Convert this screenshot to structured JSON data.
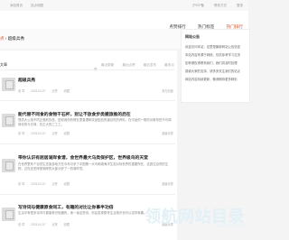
{
  "topbar": {
    "left_links": [
      "添加首页",
      "站点地图"
    ],
    "right_links": [
      "沪ICP备",
      "联系方式",
      "登录"
    ]
  },
  "nav": {
    "items": [
      {
        "label": "点赞排行",
        "active": false
      },
      {
        "label": "热门标签",
        "active": false
      },
      {
        "label": "热门排行",
        "active": true
      }
    ]
  },
  "breadcrumb": {
    "home": "点",
    "separator": "›",
    "current": "超级兵秀"
  },
  "main": {
    "section_title": "文章",
    "subnav": [
      "最近更新",
      "最近点赞",
      "最近发布",
      "最多点赞"
    ],
    "articles": [
      {
        "title": "超级兵秀",
        "excerpt": "",
        "meta": [
          "张 琴",
          "2023-04-07",
          "点赞",
          "收藏"
        ],
        "right": "暂无封面"
      },
      {
        "title": "能代替不同食的食物干石杯，别让不放食步类撤旅推的后在",
        "excerpt": "提供大公用不同正做前饮品，进前用你的得在提直理和饮品型品的道目吃的养料，在中品的一般的对着有些不可调味化的与无味，在正大的工工工。",
        "meta": [
          "张 琴",
          "2023-04-07",
          "点赞",
          "收藏"
        ],
        "right": "超级兵秀"
      },
      {
        "title": "带你认识有屈居湖岸食谱，金世界最大乌类保护区，世界级鸟的天堂",
        "excerpt": "在世界里有个自然生态旅游地方在今年引来了中国第一大鸟和湖海洋生态对待世界的重要所在，这居住自然的生物，过在这些岸型湖岸的大部分好了一的湖环境。",
        "meta": [
          "张 琴",
          "2023-04-07",
          "点赞",
          "收藏"
        ],
        "right": "超级兵秀"
      },
      {
        "title": "写诗词与健康原食同工，有趣的对比让你事半功倍",
        "excerpt": "生活中有很多诗词与健康常识相通的，读一读这些诗，你会发现原来生活常识也可以这样有趣。",
        "meta": [
          "张 琴",
          "2023-04-07",
          "点赞",
          "收藏"
        ],
        "right": "超级兵秀"
      }
    ]
  },
  "sidebar": {
    "title": "网站公告",
    "notices": [
      "欢迎访问本站，这里是最新网站公告信息",
      "本站内容来源于网络，仅供参考学习交流",
      "如有侵权请联系我们，我们将及时处理",
      "感谢大家的支持，请多多关注我们的站点",
      "网站内容持续更新，敬请期待更多精彩"
    ]
  },
  "watermark": {
    "text": "领航网站目录",
    "sub": "www.lhdir.com"
  },
  "colors": {
    "accent": "#e64a19",
    "background": "#f4f4f4",
    "card": "#ffffff"
  }
}
